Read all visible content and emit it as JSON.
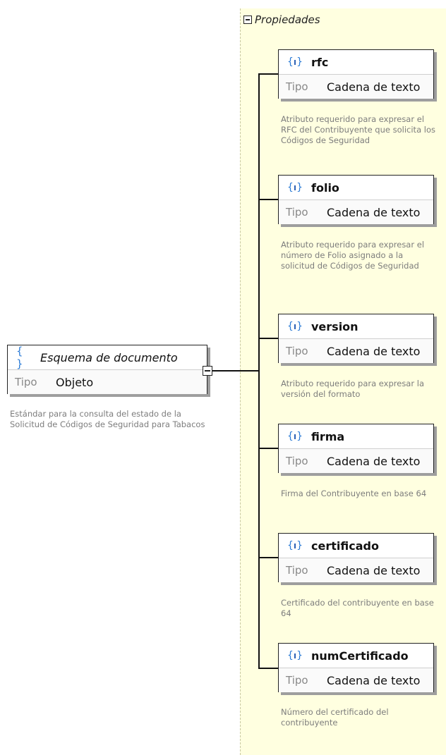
{
  "properties_header": {
    "title": "Propiedades"
  },
  "root": {
    "icon": "object-braces-icon",
    "icon_glyph": "{ }",
    "name": "Esquema de documento",
    "tipo_label": "Tipo",
    "tipo_value": "Objeto",
    "description": "Estándar para la consulta del estado de la Solicitud de Códigos de Seguridad para Tabacos"
  },
  "properties": [
    {
      "name": "rfc",
      "tipo_label": "Tipo",
      "tipo_value": "Cadena de texto",
      "description": "Atributo requerido para expresar el RFC del Contribuyente que solicita los Códigos de Seguridad"
    },
    {
      "name": "folio",
      "tipo_label": "Tipo",
      "tipo_value": "Cadena de texto",
      "description": "Atributo requerido para expresar el número de Folio asignado a la solicitud de Códigos de Seguridad"
    },
    {
      "name": "version",
      "tipo_label": "Tipo",
      "tipo_value": "Cadena de texto",
      "description": "Atributo requerido para expresar la versión del formato"
    },
    {
      "name": "firma",
      "tipo_label": "Tipo",
      "tipo_value": "Cadena de texto",
      "description": "Firma del Contribuyente en base 64"
    },
    {
      "name": "certificado",
      "tipo_label": "Tipo",
      "tipo_value": "Cadena de texto",
      "description": "Certificado del contribuyente en base 64"
    },
    {
      "name": "numCertificado",
      "tipo_label": "Tipo",
      "tipo_value": "Cadena de texto",
      "description": "Número del certificado del contribuyente"
    }
  ],
  "colors": {
    "panel_bg": "#ffffe0",
    "icon_blue": "#2b7bd6",
    "line": "#111111",
    "description_text": "#7d7d7d"
  }
}
